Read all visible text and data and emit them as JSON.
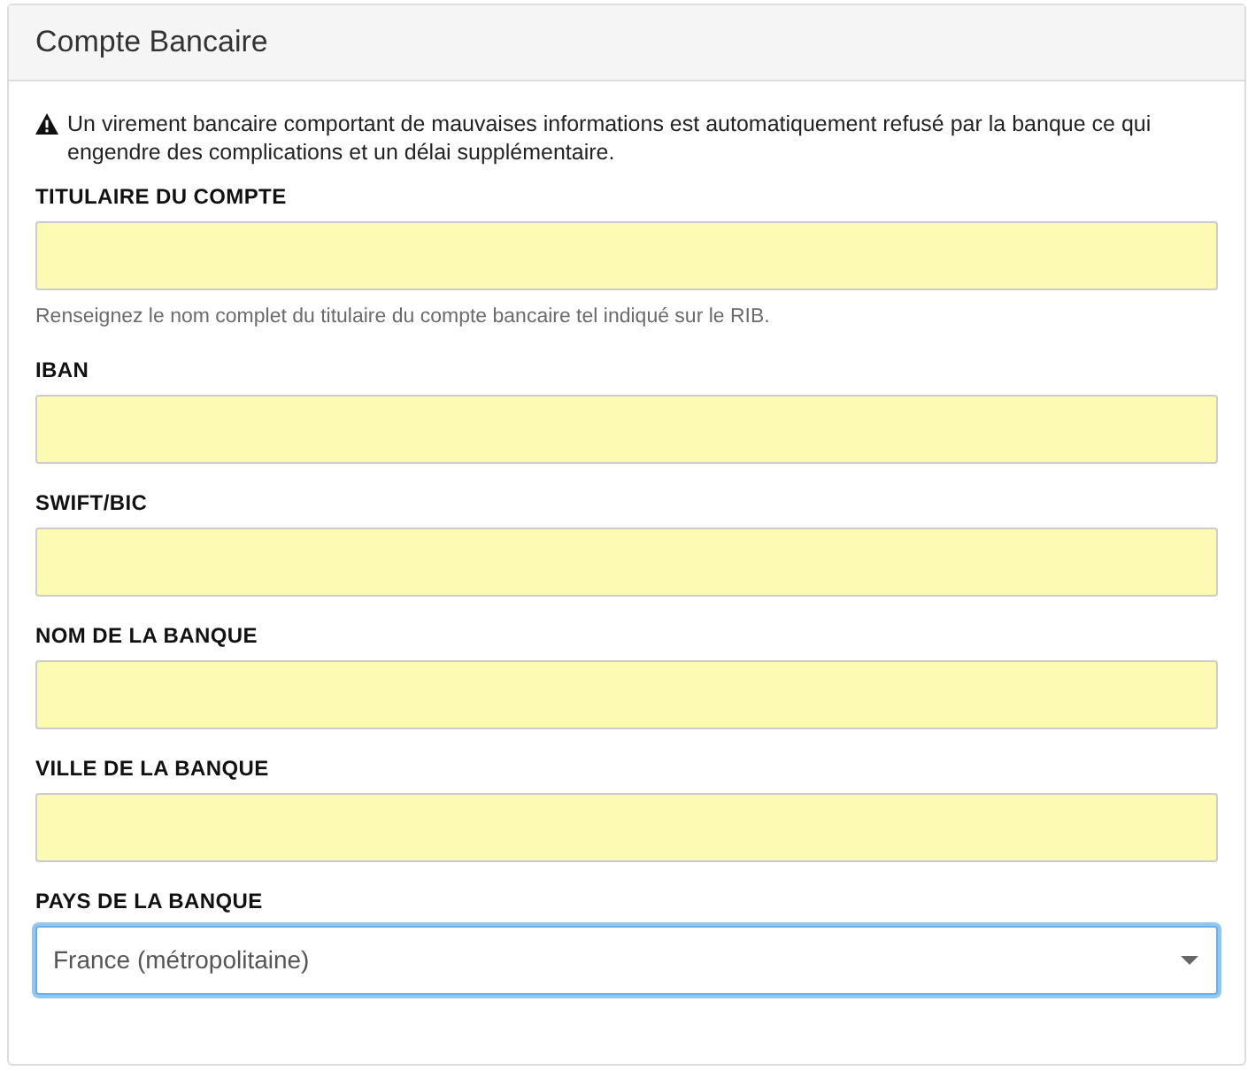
{
  "panel": {
    "title": "Compte Bancaire"
  },
  "warning": "Un virement bancaire comportant de mauvaises informations est automatiquement refusé par la banque ce qui engendre des complications et un délai supplémentaire.",
  "fields": [
    {
      "kind": "text",
      "label": "TITULAIRE DU COMPTE",
      "autofilled": true,
      "focused": false,
      "help": "Renseignez le nom complet du titulaire du compte bancaire tel indiqué sur le RIB."
    },
    {
      "kind": "text",
      "label": "IBAN",
      "autofilled": true,
      "focused": false
    },
    {
      "kind": "text",
      "label": "SWIFT/BIC",
      "autofilled": true,
      "focused": false
    },
    {
      "kind": "text",
      "label": "NOM DE LA BANQUE",
      "autofilled": true,
      "focused": false
    },
    {
      "kind": "text",
      "label": "VILLE DE LA BANQUE",
      "autofilled": true,
      "focused": false
    },
    {
      "kind": "select",
      "label": "PAYS DE LA BANQUE",
      "value": "France (métropolitaine)",
      "autofilled": false,
      "focused": true
    }
  ]
}
